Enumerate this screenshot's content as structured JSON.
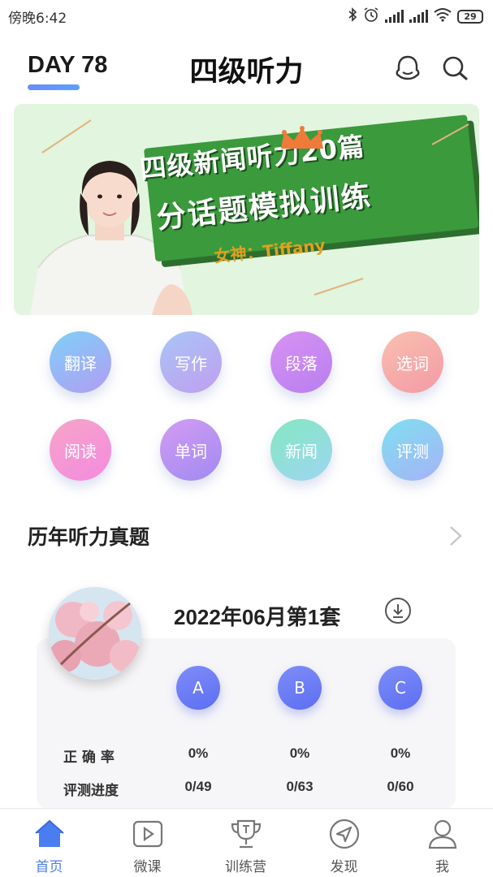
{
  "status_bar": {
    "time": "傍晚6:42",
    "battery": "29"
  },
  "header": {
    "day_badge": "DAY 78",
    "title": "四级听力",
    "icons": [
      "message-icon",
      "search-icon"
    ]
  },
  "banner": {
    "line1": "四级新闻听力20篇",
    "line2": "分话题模拟训练",
    "host": "女神：Tiffany"
  },
  "categories": [
    {
      "label": "翻译",
      "color": "#8fb4f7"
    },
    {
      "label": "写作",
      "color": "#b6a8ef"
    },
    {
      "label": "段落",
      "color": "#c58aef"
    },
    {
      "label": "选词",
      "color": "#f6a6a6"
    },
    {
      "label": "阅读",
      "color": "#f2a0d6"
    },
    {
      "label": "单词",
      "color": "#b59af2"
    },
    {
      "label": "新闻",
      "color": "#8fe0c8"
    },
    {
      "label": "评测",
      "color": "#8cc8f5"
    }
  ],
  "section": {
    "title": "历年听力真题"
  },
  "exam": {
    "title": "2022年06月第1套",
    "levels": [
      "A",
      "B",
      "C"
    ],
    "accuracy_label": "正 确 率",
    "progress_label": "评测进度",
    "accuracy": [
      "0%",
      "0%",
      "0%"
    ],
    "progress": [
      "0/49",
      "0/63",
      "0/60"
    ]
  },
  "bottom_nav": [
    {
      "label": "首页",
      "icon": "home-icon",
      "active": true
    },
    {
      "label": "微课",
      "icon": "video-play-icon",
      "active": false
    },
    {
      "label": "训练营",
      "icon": "trophy-icon",
      "active": false
    },
    {
      "label": "发现",
      "icon": "compass-icon",
      "active": false
    },
    {
      "label": "我",
      "icon": "user-icon",
      "active": false
    }
  ],
  "colors": {
    "accent": "#4a7ef0",
    "banner_bg": "#e2f5df",
    "banner_stripe": "#3a9a3c",
    "level_button": "#6a7cf5"
  }
}
